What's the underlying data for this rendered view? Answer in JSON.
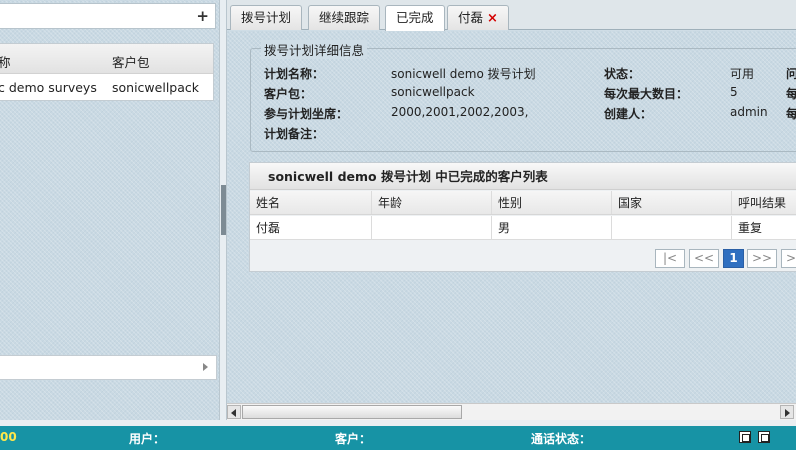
{
  "left": {
    "add_label": "+",
    "headers": [
      "称",
      "客户包"
    ],
    "rows": [
      [
        "c demo surveys",
        "sonicwellpack"
      ]
    ]
  },
  "tabs": [
    {
      "label": "拨号计划"
    },
    {
      "label": "继续跟踪"
    },
    {
      "label": "已完成"
    },
    {
      "label": "付磊",
      "close": "×"
    }
  ],
  "detail": {
    "legend": "拨号计划详细信息",
    "plan_name_label": "计划名称：",
    "plan_name": "sonicwell demo 拨号计划",
    "pack_label": "客户包：",
    "pack": "sonicwellpack",
    "seats_label": "参与计划坐席：",
    "seats": "2000,2001,2002,2003,",
    "notes_label": "计划备注：",
    "status_label": "状态：",
    "status": "可用",
    "max_label": "每次最大数目：",
    "max": "5",
    "creator_label": "创建人：",
    "creator": "admin",
    "extra1": "问",
    "extra2": "每",
    "extra3": "每"
  },
  "grid": {
    "title": "sonicwell demo 拨号计划 中已完成的客户列表",
    "columns": [
      "姓名",
      "年龄",
      "性别",
      "国家",
      "呼叫结果"
    ],
    "rows": [
      [
        "付磊",
        "",
        "男",
        "",
        "重复"
      ]
    ],
    "pager": {
      "first": "|<",
      "prev": "<<",
      "current": "1",
      "next": ">>",
      "last": ">"
    }
  },
  "status_bar": {
    "time": "00",
    "user_label": "用户：",
    "customer_label": "客户：",
    "call_status_label": "通话状态："
  }
}
